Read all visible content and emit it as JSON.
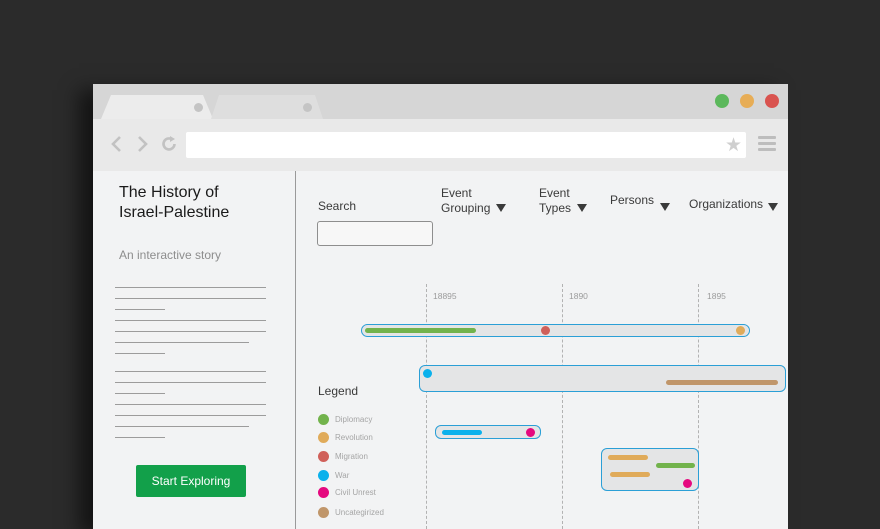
{
  "browser": {
    "tabs": [
      {
        "label": ""
      },
      {
        "label": ""
      }
    ],
    "address": "",
    "window_buttons": [
      {
        "name": "maximize",
        "color": "#5cb85c"
      },
      {
        "name": "minimize",
        "color": "#e7ad56"
      },
      {
        "name": "close",
        "color": "#d9534f"
      }
    ],
    "icons": [
      "back-icon",
      "forward-icon",
      "reload-icon",
      "star-icon",
      "menu-icon"
    ]
  },
  "sidebar": {
    "title": "The History of Israel-Palestine",
    "subtitle": "An interactive story",
    "start_button": "Start Exploring",
    "accent": "#12a04a"
  },
  "filters": {
    "search_label": "Search",
    "search_value": "",
    "event_grouping": "Event Grouping",
    "event_types": "Event Types",
    "persons": "Persons",
    "organizations": "Organizations"
  },
  "timeline": {
    "ticks": [
      "18895",
      "1890",
      "1895"
    ]
  },
  "legend": {
    "title": "Legend",
    "items": [
      {
        "label": "Diplomacy",
        "color": "#72b34c"
      },
      {
        "label": "Revolution",
        "color": "#e0ab5a"
      },
      {
        "label": "Migration",
        "color": "#d0605a"
      },
      {
        "label": "War",
        "color": "#0ab1ec"
      },
      {
        "label": "Civil Unrest",
        "color": "#e5097f"
      },
      {
        "label": "Uncategirized",
        "color": "#c0966a"
      }
    ]
  }
}
